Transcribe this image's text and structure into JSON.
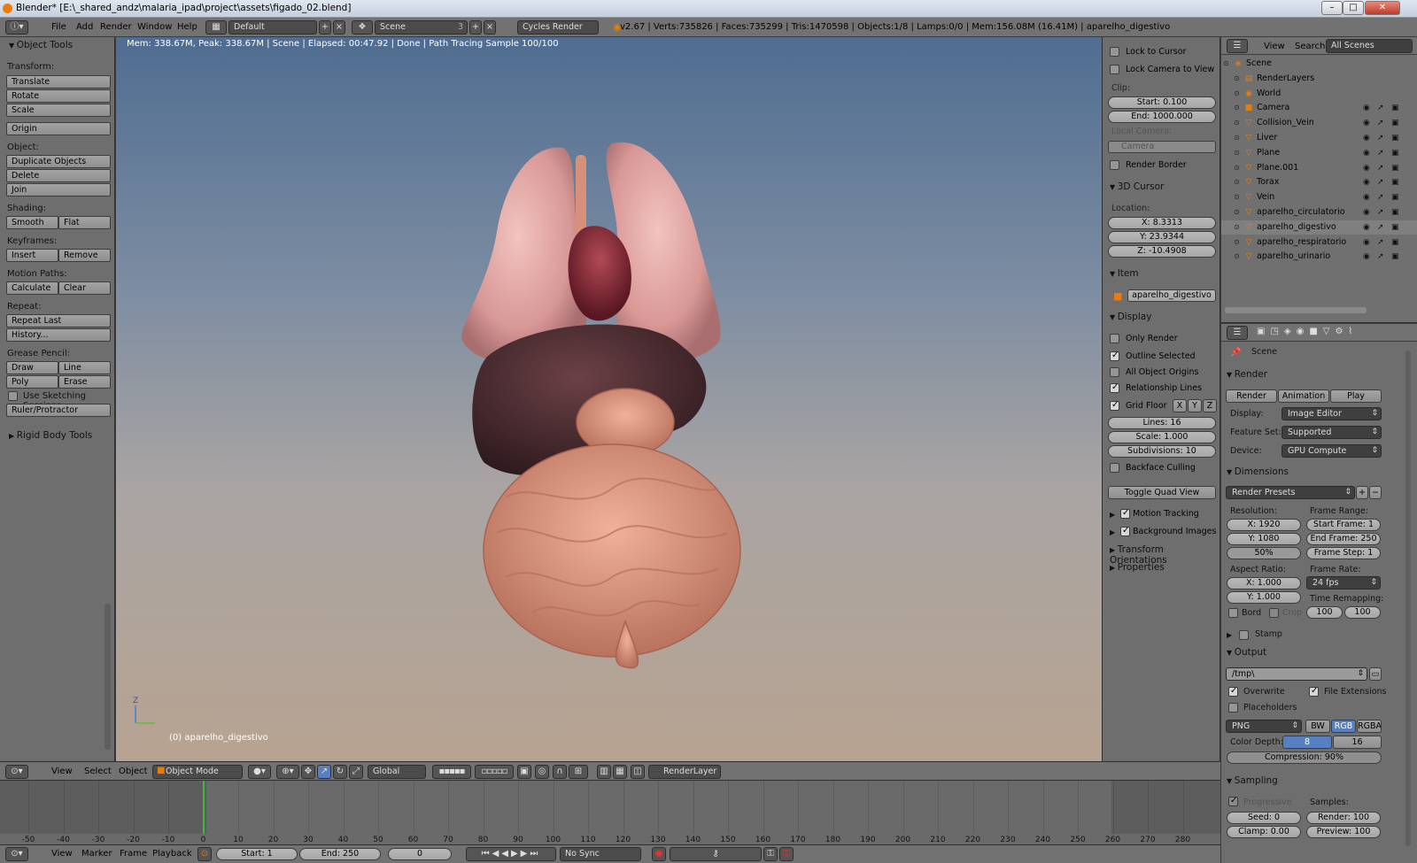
{
  "window": {
    "title": "Blender* [E:\\_shared_andz\\malaria_ipad\\project\\assets\\figado_02.blend]",
    "min": "–",
    "max": "□",
    "close": "✕"
  },
  "info": {
    "menus": [
      "File",
      "Add",
      "Render",
      "Window",
      "Help"
    ],
    "screen": "Default",
    "scene": "Scene",
    "scene_count": "3",
    "engine": "Cycles Render",
    "stats": "v2.67 | Verts:735826 | Faces:735299 | Tris:1470598 | Objects:1/8 | Lamps:0/0 | Mem:156.08M (16.41M) | aparelho_digestivo"
  },
  "toolshelf": {
    "title": "Object Tools",
    "transform_h": "Transform:",
    "translate": "Translate",
    "rotate": "Rotate",
    "scale": "Scale",
    "origin": "Origin",
    "object_h": "Object:",
    "duplicate": "Duplicate Objects",
    "delete": "Delete",
    "join": "Join",
    "shading_h": "Shading:",
    "smooth": "Smooth",
    "flat": "Flat",
    "keyframes_h": "Keyframes:",
    "insert": "Insert",
    "remove": "Remove",
    "motion_h": "Motion Paths:",
    "calculate": "Calculate",
    "clear": "Clear",
    "repeat_h": "Repeat:",
    "repeat_last": "Repeat Last",
    "history": "History...",
    "grease_h": "Grease Pencil:",
    "draw": "Draw",
    "line": "Line",
    "poly": "Poly",
    "erase": "Erase",
    "sketch": "Use Sketching Sessions",
    "ruler": "Ruler/Protractor",
    "rigid": "Rigid Body Tools"
  },
  "viewport": {
    "render_info": "Mem: 338.67M, Peak: 338.67M | Scene | Elapsed: 00:47.92 | Done | Path Tracing Sample 100/100",
    "object_label": "(0) aparelho_digestivo",
    "axis_z": "Z"
  },
  "npanel": {
    "lock_cursor": "Lock to Cursor",
    "lock_camera": "Lock Camera to View",
    "clip": "Clip:",
    "clip_start": "Start: 0.100",
    "clip_end": "End: 1000.000",
    "local_camera": "Local Camera:",
    "camera": "Camera",
    "render_border": "Render Border",
    "cursor_title": "3D Cursor",
    "location": "Location:",
    "x": "X: 8.3313",
    "y": "Y: 23.9344",
    "z": "Z: -10.4908",
    "item_title": "Item",
    "item_name": "aparelho_digestivo",
    "display_title": "Display",
    "only_render": "Only Render",
    "outline_selected": "Outline Selected",
    "all_origins": "All Object Origins",
    "relationship_lines": "Relationship Lines",
    "grid_floor": "Grid Floor",
    "gx": "X",
    "gy": "Y",
    "gz": "Z",
    "lines": "Lines: 16",
    "gscale": "Scale: 1.000",
    "subdivisions": "Subdivisions: 10",
    "backface": "Backface Culling",
    "quad_view": "Toggle Quad View",
    "motion_tracking": "Motion Tracking",
    "background_images": "Background Images",
    "transform_orientations": "Transform Orientations",
    "properties": "Properties"
  },
  "outliner": {
    "view": "View",
    "search": "Search",
    "all_scenes": "All Scenes",
    "rows": [
      {
        "name": "Scene",
        "ico": "◈"
      },
      {
        "name": "RenderLayers",
        "ico": "▤"
      },
      {
        "name": "World",
        "ico": "◉"
      },
      {
        "name": "Camera",
        "ico": "■"
      },
      {
        "name": "Collision_Vein",
        "ico": "▽"
      },
      {
        "name": "Liver",
        "ico": "▽"
      },
      {
        "name": "Plane",
        "ico": "▽"
      },
      {
        "name": "Plane.001",
        "ico": "▽"
      },
      {
        "name": "Torax",
        "ico": "▽"
      },
      {
        "name": "Vein",
        "ico": "▽"
      },
      {
        "name": "aparelho_circulatorio",
        "ico": "▽"
      },
      {
        "name": "aparelho_digestivo",
        "ico": "▽"
      },
      {
        "name": "aparelho_respiratorio",
        "ico": "▽"
      },
      {
        "name": "aparelho_urinario",
        "ico": "▽"
      }
    ]
  },
  "props": {
    "scene": "Scene",
    "render_title": "Render",
    "render_btn": "Render",
    "animation_btn": "Animation",
    "play_btn": "Play",
    "display_label": "Display:",
    "display_val": "Image Editor",
    "feature_label": "Feature Set:",
    "feature_val": "Supported",
    "device_label": "Device:",
    "device_val": "GPU Compute",
    "dimensions_title": "Dimensions",
    "presets": "Render Presets",
    "resolution": "Resolution:",
    "res_x": "X: 1920",
    "res_y": "Y: 1080",
    "res_pct": "50%",
    "frame_range": "Frame Range:",
    "start_frame": "Start Frame: 1",
    "end_frame": "End Frame: 250",
    "frame_step": "Frame Step: 1",
    "aspect": "Aspect Ratio:",
    "asp_x": "X: 1.000",
    "asp_y": "Y: 1.000",
    "frame_rate": "Frame Rate:",
    "fps": "24 fps",
    "time_remap": "Time Remapping:",
    "remap_old": "100",
    "remap_new": "100",
    "bord": "Bord",
    "crop": "Crop",
    "stamp_title": "Stamp",
    "output_title": "Output",
    "path": "/tmp\\",
    "overwrite": "Overwrite",
    "file_ext": "File Extensions",
    "placeholders": "Placeholders",
    "format": "PNG",
    "bw": "BW",
    "rgb": "RGB",
    "rgba": "RGBA",
    "color_depth": "Color Depth:",
    "depth8": "8",
    "depth16": "16",
    "compression": "Compression: 90%",
    "sampling_title": "Sampling",
    "progressive": "Progressive",
    "samples": "Samples:",
    "seed": "Seed: 0",
    "render_samples": "Render: 100",
    "clamp": "Clamp: 0.00",
    "preview_samples": "Preview: 100"
  },
  "vpheader": {
    "view": "View",
    "select": "Select",
    "object": "Object",
    "mode": "Object Mode",
    "orientation": "Global",
    "renderlayer": "RenderLayer"
  },
  "timeline": {
    "ticks": [
      "-50",
      "-40",
      "-30",
      "-20",
      "-10",
      "0",
      "10",
      "20",
      "30",
      "40",
      "50",
      "60",
      "70",
      "80",
      "90",
      "100",
      "110",
      "120",
      "130",
      "140",
      "150",
      "160",
      "170",
      "180",
      "190",
      "200",
      "210",
      "220",
      "230",
      "240",
      "250",
      "260",
      "270",
      "280"
    ],
    "current_frame": 0
  },
  "tlheader": {
    "view": "View",
    "marker": "Marker",
    "frame": "Frame",
    "playback": "Playback",
    "start": "Start: 1",
    "end": "End: 250",
    "current": "0",
    "sync": "No Sync"
  },
  "colors": {
    "accent": "#e87d0d",
    "select": "#5680c2",
    "frame_marker": "#3dbb3d"
  }
}
